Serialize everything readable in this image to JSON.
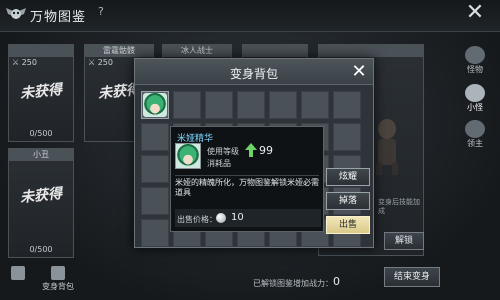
{
  "header": {
    "title": "万物图鉴",
    "help_icon": "question-icon",
    "close_icon": "close-icon",
    "logo_icon": "skull-wings-icon"
  },
  "cards": [
    {
      "name": "",
      "power": "250",
      "status": "未获得",
      "progress": "0/500"
    },
    {
      "name": "雷霆骷髅",
      "power": "250",
      "status": "未获得",
      "progress": ""
    },
    {
      "name": "冰人战士",
      "power": "",
      "status": "",
      "progress": ""
    },
    {
      "name": "",
      "power": "",
      "status": "",
      "progress": ""
    },
    {
      "name": "",
      "power": "",
      "status": "",
      "progress": ""
    },
    {
      "name": "小丑",
      "power": "",
      "status": "未获得",
      "progress": "0/500"
    }
  ],
  "side_tabs": [
    {
      "label": "怪物",
      "icon": "monster-icon",
      "active": false
    },
    {
      "label": "小怪",
      "icon": "minion-icon",
      "active": true
    },
    {
      "label": "领主",
      "icon": "lord-icon",
      "active": false
    }
  ],
  "right_panel": {
    "effect_text": "变身后技能加成",
    "unlock_label": "解锁"
  },
  "bottom": {
    "tools": [
      {
        "label": "",
        "icon": "list-icon"
      },
      {
        "label": "变身背包",
        "icon": "bag-icon"
      }
    ],
    "info_label": "已解锁图鉴增加战力：",
    "info_value": "0",
    "end_label": "结束变身"
  },
  "dialog": {
    "title": "变身背包",
    "close_icon": "close-icon",
    "grid_rows": 5,
    "grid_cols": 7,
    "filled_slots": [
      0
    ]
  },
  "tooltip": {
    "name": "米娅精华",
    "usage_label": "使用等级",
    "level": "99",
    "type": "消耗品",
    "description": "米娅的精魄所化，万物图鉴解锁米娅必需道具",
    "price_label": "出售价格：",
    "price": "10",
    "coin_icon": "silver-coin-icon"
  },
  "actions": [
    {
      "label": "炫耀",
      "style": "normal"
    },
    {
      "label": "掉落",
      "style": "normal"
    },
    {
      "label": "出售",
      "style": "sell"
    }
  ]
}
